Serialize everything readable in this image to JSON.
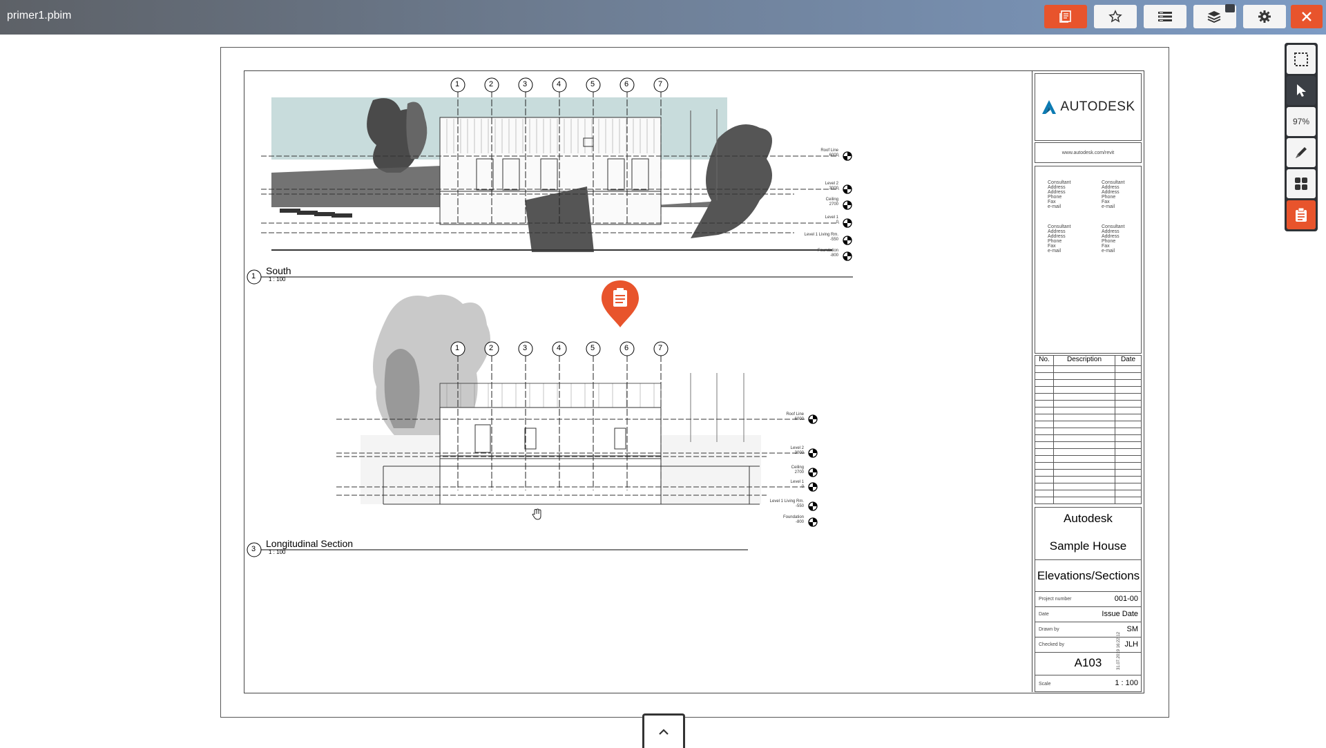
{
  "app": {
    "title": "primer1.pbim"
  },
  "toolbar": {
    "zoom": "97%"
  },
  "views": [
    {
      "number": "1",
      "name": "South",
      "scale": "1 : 100"
    },
    {
      "number": "3",
      "name": "Longitudinal Section",
      "scale": "1 : 100"
    }
  ],
  "grid_labels": [
    "1",
    "2",
    "3",
    "4",
    "5",
    "6",
    "7"
  ],
  "levels_top": [
    {
      "name": "Roof Line",
      "value": "6000"
    },
    {
      "name": "Level 2",
      "value": "3000"
    },
    {
      "name": "Ceiling",
      "value": "2700"
    },
    {
      "name": "Level 1",
      "value": "0"
    },
    {
      "name": "Level 1 Living Rm.",
      "value": "-550"
    },
    {
      "name": "Foundation",
      "value": "-800"
    }
  ],
  "levels_bottom": [
    {
      "name": "Roof Line",
      "value": "6000"
    },
    {
      "name": "Level 2",
      "value": "3000"
    },
    {
      "name": "Ceiling",
      "value": "2700"
    },
    {
      "name": "Level 1",
      "value": "0"
    },
    {
      "name": "Level 1 Living Rm.",
      "value": "-550"
    },
    {
      "name": "Foundation",
      "value": "-800"
    }
  ],
  "titleblock": {
    "logo": "AUTODESK",
    "url": "www.autodesk.com/revit",
    "consultant_lines": [
      "Consultant",
      "Address",
      "Address",
      "Phone",
      "Fax",
      "e-mail"
    ],
    "rev_headers": [
      "No.",
      "Description",
      "Date"
    ],
    "company": "Autodesk",
    "project": "Sample House",
    "sheet_name": "Elevations/Sections",
    "fields": [
      {
        "label": "Project number",
        "value": "001-00"
      },
      {
        "label": "Date",
        "value": "Issue Date"
      },
      {
        "label": "Drawn by",
        "value": "SM"
      },
      {
        "label": "Checked by",
        "value": "JLH"
      }
    ],
    "sheet_number": "A103",
    "scale_label": "Scale",
    "scale_value": "1 : 100",
    "print_date": "31.07.2019 16:22:12"
  },
  "colors": {
    "accent": "#e8542c",
    "toolbar_dark": "#3b3f45"
  }
}
